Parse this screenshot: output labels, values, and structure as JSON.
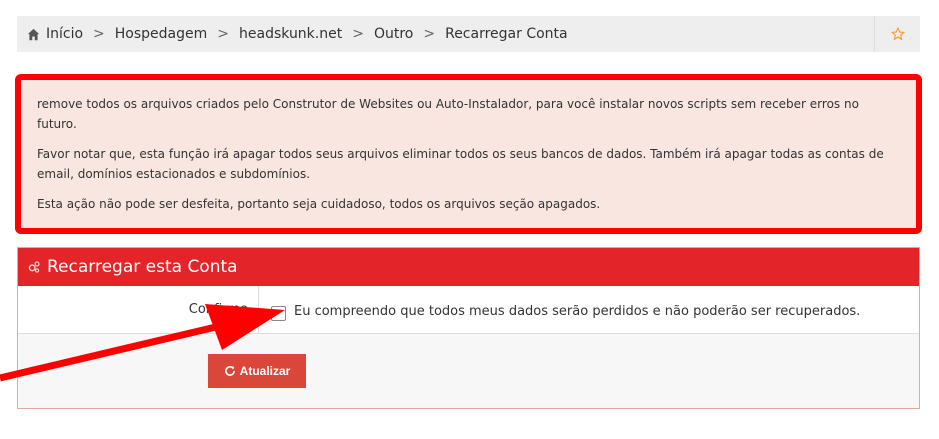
{
  "breadcrumb": {
    "items": [
      "Início",
      "Hospedagem",
      "headskunk.net",
      "Outro",
      "Recarregar Conta"
    ],
    "separator": ">",
    "home_icon": "home-icon",
    "star_icon": "star-icon"
  },
  "alert": {
    "paragraphs": [
      "remove todos os arquivos criados pelo Construtor de Websites ou Auto-Instalador, para você instalar novos scripts sem receber erros no futuro.",
      "Favor notar que, esta função irá apagar todos seus arquivos eliminar todos os seus bancos de dados. Também irá apagar todas as contas de email, domínios estacionados e subdomínios.",
      "Esta ação não pode ser desfeita, portanto seja cuidadoso, todos os arquivos seção apagados."
    ],
    "border_color": "#ff0000"
  },
  "panel": {
    "title": "Recarregar esta Conta",
    "header_color": "#e3252a",
    "confirm_label": "Confirme",
    "checkbox_text": "Eu compreendo que todos meus dados serão perdidos e não poderão ser recuperados.",
    "checkbox_checked": false,
    "button_label": "Atualizar",
    "button_color": "#d9463a"
  },
  "annotation": {
    "arrow_color": "#ff0000"
  }
}
